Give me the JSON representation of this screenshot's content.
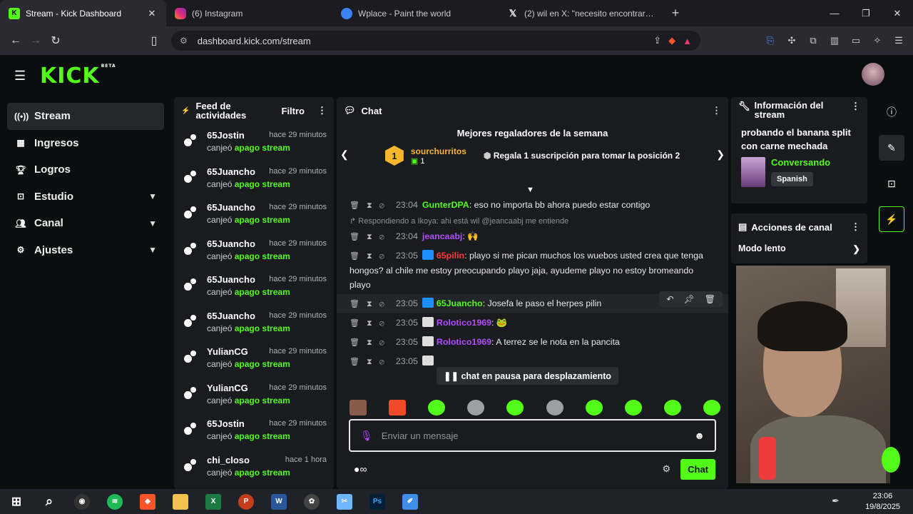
{
  "browser": {
    "tabs": [
      {
        "title": "Stream - Kick Dashboard",
        "icon": "kick-icon",
        "color": "#53fc18"
      },
      {
        "title": "(6) Instagram",
        "icon": "instagram-icon",
        "color": "#e1306c"
      },
      {
        "title": "Wplace - Paint the world",
        "icon": "globe-icon",
        "color": "#3b82f6"
      },
      {
        "title": "(2) wil en X: \"necesito encontrar a est",
        "icon": "x-icon",
        "color": "#000000"
      }
    ],
    "url": "dashboard.kick.com/stream"
  },
  "header": {
    "logo": "KICK",
    "beta": "BETA"
  },
  "sidebar": {
    "items": [
      {
        "label": "Stream",
        "icon": "broadcast-icon"
      },
      {
        "label": "Ingresos",
        "icon": "revenue-icon"
      },
      {
        "label": "Logros",
        "icon": "trophy-icon"
      },
      {
        "label": "Estudio",
        "icon": "studio-icon"
      },
      {
        "label": "Canal",
        "icon": "channel-icon"
      },
      {
        "label": "Ajustes",
        "icon": "settings-icon"
      }
    ]
  },
  "feed": {
    "title": "Feed de actividades",
    "filter": "Filtro",
    "items": [
      {
        "user": "65Jostin",
        "time": "hace 29 minutos",
        "action": "canjeó",
        "reward": "apago stream"
      },
      {
        "user": "65Juancho",
        "time": "hace 29 minutos",
        "action": "canjeó",
        "reward": "apago stream"
      },
      {
        "user": "65Juancho",
        "time": "hace 29 minutos",
        "action": "canjeó",
        "reward": "apago stream"
      },
      {
        "user": "65Juancho",
        "time": "hace 29 minutos",
        "action": "canjeó",
        "reward": "apago stream"
      },
      {
        "user": "65Juancho",
        "time": "hace 29 minutos",
        "action": "canjeó",
        "reward": "apago stream"
      },
      {
        "user": "65Juancho",
        "time": "hace 29 minutos",
        "action": "canjeó",
        "reward": "apago stream"
      },
      {
        "user": "YulianCG",
        "time": "hace 29 minutos",
        "action": "canjeó",
        "reward": "apago stream"
      },
      {
        "user": "YulianCG",
        "time": "hace 29 minutos",
        "action": "canjeó",
        "reward": "apago stream"
      },
      {
        "user": "65Jostin",
        "time": "hace 29 minutos",
        "action": "canjeó",
        "reward": "apago stream"
      },
      {
        "user": "chi_closo",
        "time": "hace 1 hora",
        "action": "canjeó",
        "reward": "apago stream"
      }
    ]
  },
  "chat": {
    "title": "Chat",
    "top_gifters_title": "Mejores regaladores de la semana",
    "top_gifter": {
      "rank": "1",
      "name": "sourchurritos",
      "count": "1"
    },
    "gift_cta": "Regala 1 suscripción para tomar la posición 2",
    "messages": [
      {
        "time": "23:04",
        "user": "GunterDPA",
        "color": "#53fc18",
        "text": "eso no importa bb ahora puedo estar contigo"
      },
      {
        "time": "23:04",
        "user": "jeancaabj",
        "color": "#b14cff",
        "text": "🙌",
        "reply": "Respondiendo a Ikoya: ahi está wil @jeancaabj me entiende"
      },
      {
        "time": "23:05",
        "user": "65pilin",
        "color": "#ff3b3b",
        "text": "playo si me pican muchos los wuebos usted crea que tenga hongos? al chile me estoy preocupando playo jaja, ayudeme playo no estoy bromeando playo"
      },
      {
        "time": "23:05",
        "user": "65Juancho",
        "color": "#53fc18",
        "text": "Josefa le paso el herpes pilin"
      },
      {
        "time": "23:05",
        "user": "Rolotico1969",
        "color": "#b14cff",
        "text": "🐸"
      },
      {
        "time": "23:05",
        "user": "Rolotico1969",
        "color": "#b14cff",
        "text": "A terrez se le nota en la pancita"
      },
      {
        "time": "23:05",
        "user": "",
        "color": "#b14cff",
        "text": ""
      }
    ],
    "paused": "chat en pausa para desplazamiento",
    "placeholder": "Enviar un mensaje",
    "send": "Chat"
  },
  "info": {
    "title": "Información del stream",
    "stream_title": "probando el banana split con carne mechada",
    "category": "Conversando",
    "language": "Spanish"
  },
  "actions": {
    "title": "Acciones de canal",
    "slow_mode": "Modo lento"
  },
  "taskbar": {
    "time": "23:06",
    "date": "19/8/2025"
  }
}
